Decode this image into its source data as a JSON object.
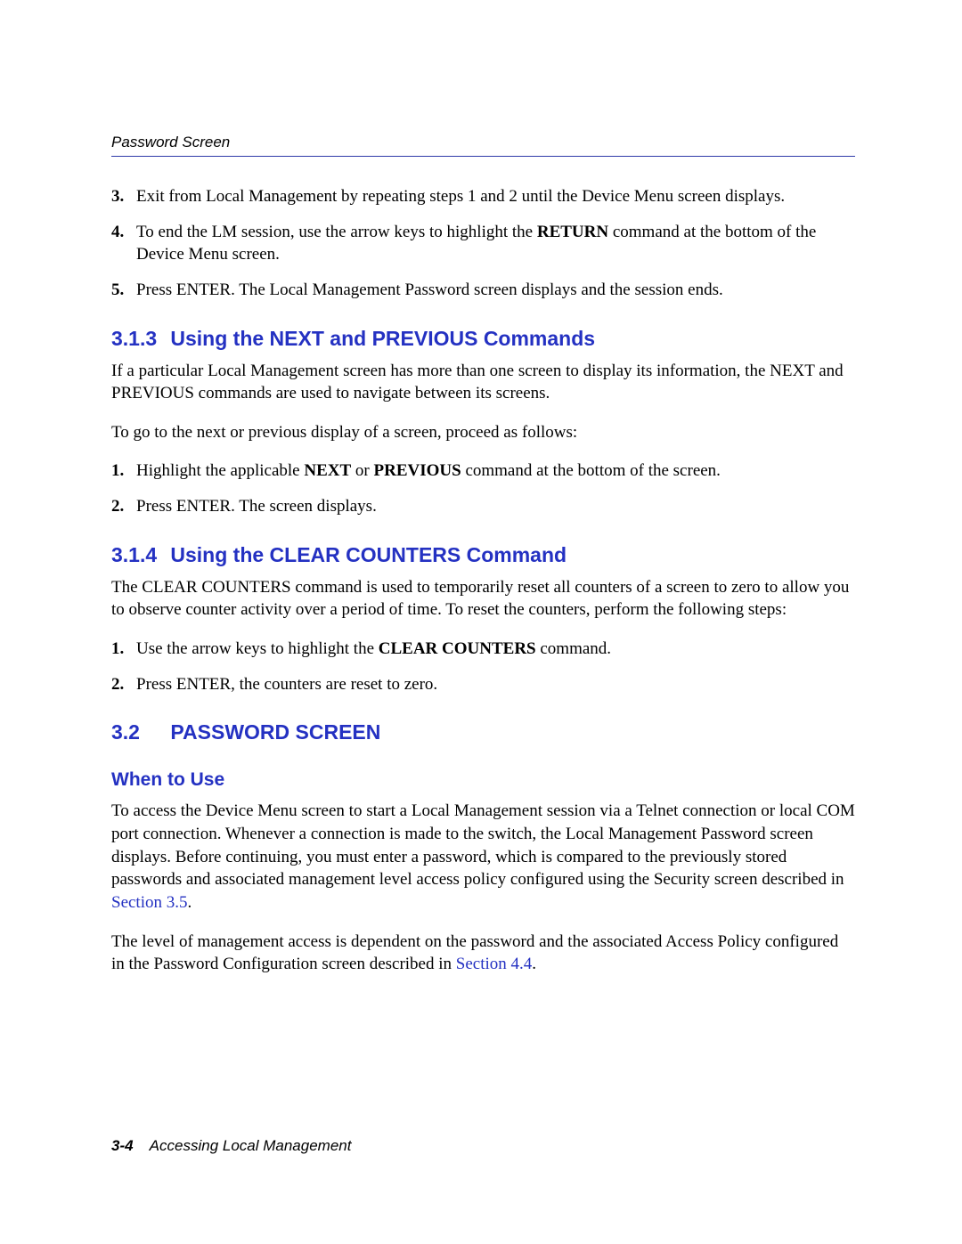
{
  "header": {
    "breadcrumb": "Password Screen"
  },
  "top_list": [
    {
      "num": "3.",
      "parts": [
        {
          "t": "Exit from Local Management by repeating steps 1 and 2 until the Device Menu screen displays.",
          "b": false
        }
      ]
    },
    {
      "num": "4.",
      "parts": [
        {
          "t": "To end the LM session, use the arrow keys to highlight the ",
          "b": false
        },
        {
          "t": "RETURN",
          "b": true
        },
        {
          "t": " command at the bottom of the Device Menu screen.",
          "b": false
        }
      ]
    },
    {
      "num": "5.",
      "parts": [
        {
          "t": "Press ENTER. The Local Management Password screen displays and the session ends.",
          "b": false
        }
      ]
    }
  ],
  "section_313": {
    "num": "3.1.3",
    "title": "Using the NEXT and PREVIOUS Commands",
    "para1": "If a particular Local Management screen has more than one screen to display its information, the NEXT and PREVIOUS commands are used to navigate between its screens.",
    "para2": "To go to the next or previous display of a screen, proceed as follows:",
    "list": [
      {
        "num": "1.",
        "parts": [
          {
            "t": "Highlight the applicable ",
            "b": false
          },
          {
            "t": "NEXT",
            "b": true
          },
          {
            "t": " or ",
            "b": false
          },
          {
            "t": "PREVIOUS",
            "b": true
          },
          {
            "t": " command at the bottom of the screen.",
            "b": false
          }
        ]
      },
      {
        "num": "2.",
        "parts": [
          {
            "t": "Press ENTER. The screen displays.",
            "b": false
          }
        ]
      }
    ]
  },
  "section_314": {
    "num": "3.1.4",
    "title": "Using the CLEAR COUNTERS Command",
    "para1": "The CLEAR COUNTERS command is used to temporarily reset all counters of a screen to zero to allow you to observe counter activity over a period of time. To reset the counters, perform the following steps:",
    "list": [
      {
        "num": "1.",
        "parts": [
          {
            "t": "Use the arrow keys to highlight the ",
            "b": false
          },
          {
            "t": "CLEAR COUNTERS",
            "b": true
          },
          {
            "t": " command.",
            "b": false
          }
        ]
      },
      {
        "num": "2.",
        "parts": [
          {
            "t": "Press ENTER, the counters are reset to zero.",
            "b": false
          }
        ]
      }
    ]
  },
  "section_32": {
    "num": "3.2",
    "title": "PASSWORD SCREEN",
    "subhead": "When to Use",
    "para1_parts": [
      {
        "t": "To access the Device Menu screen to start a Local Management session via a Telnet connection or local COM port connection. Whenever a connection is made to the switch, the Local Management Password screen displays. Before continuing, you must enter a password, which is compared to the previously stored passwords and associated management level access policy configured using the Security screen described in ",
        "link": false
      },
      {
        "t": "Section 3.5",
        "link": true
      },
      {
        "t": ".",
        "link": false
      }
    ],
    "para2_parts": [
      {
        "t": "The level of management access is dependent on the password and the associated Access Policy configured in the Password Configuration screen described in ",
        "link": false
      },
      {
        "t": "Section 4.4",
        "link": true
      },
      {
        "t": ".",
        "link": false
      }
    ]
  },
  "footer": {
    "page_num": "3-4",
    "chapter": "Accessing Local Management"
  }
}
